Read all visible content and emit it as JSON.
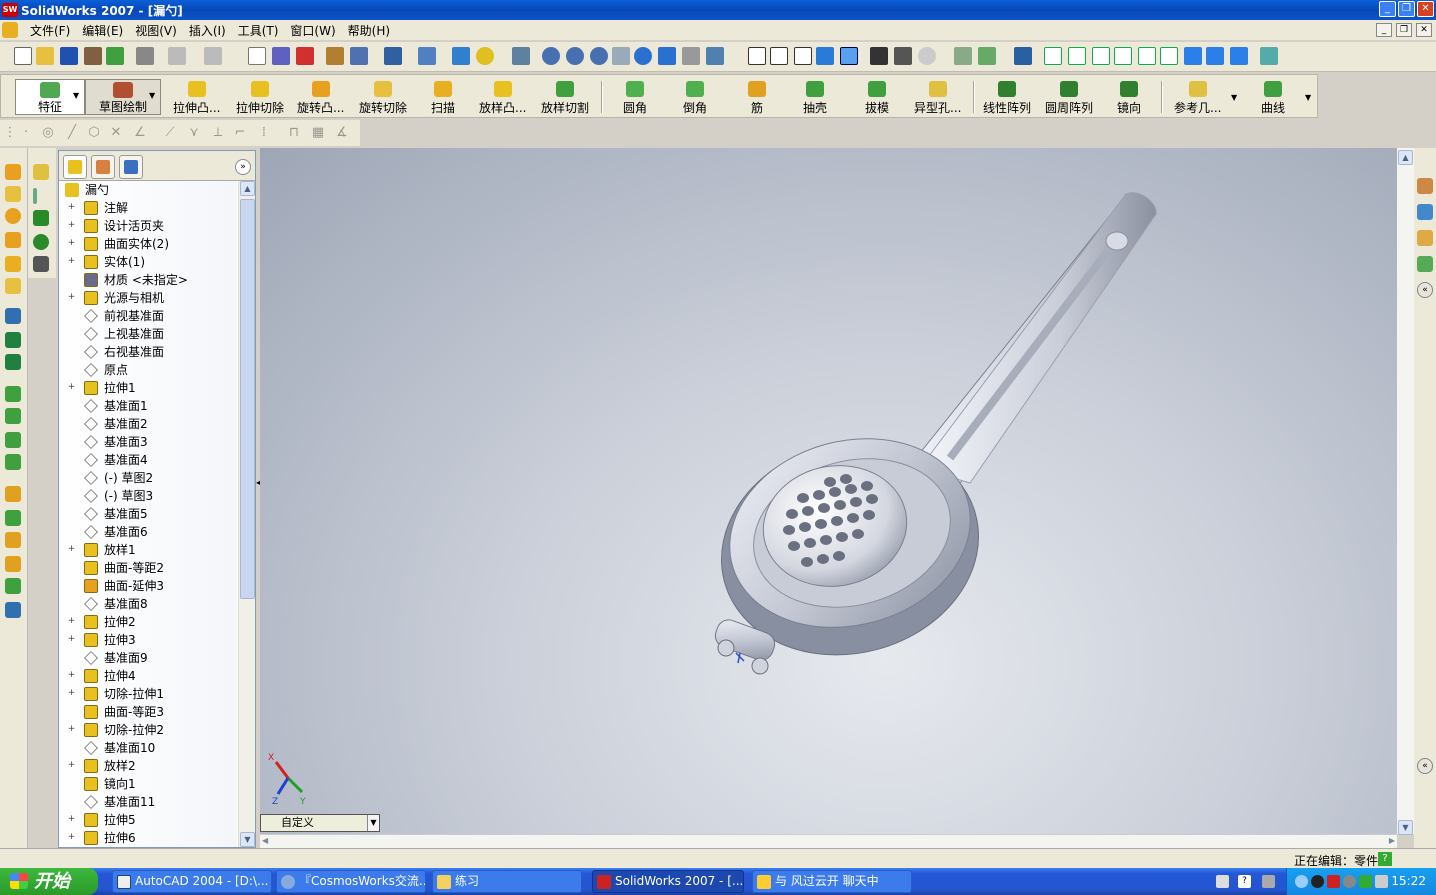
{
  "window": {
    "title": "SolidWorks 2007 - [漏勺]",
    "app_icon": "SW"
  },
  "menu": [
    "文件(F)",
    "编辑(E)",
    "视图(V)",
    "插入(I)",
    "工具(T)",
    "窗口(W)",
    "帮助(H)"
  ],
  "command_manager": {
    "tabs": [
      {
        "label": "特征"
      },
      {
        "label": "草图绘制"
      }
    ],
    "items": [
      {
        "label": "拉伸凸...",
        "color": "#e8c020"
      },
      {
        "label": "拉伸切除",
        "color": "#e8c020"
      },
      {
        "label": "旋转凸...",
        "color": "#e8a020"
      },
      {
        "label": "旋转切除",
        "color": "#e8c040"
      },
      {
        "label": "扫描",
        "color": "#e8b020"
      },
      {
        "label": "放样凸...",
        "color": "#e8c020"
      },
      {
        "label": "放样切割",
        "color": "#40a040"
      },
      {
        "label": "圆角",
        "color": "#50b050"
      },
      {
        "label": "倒角",
        "color": "#50b050"
      },
      {
        "label": "筋",
        "color": "#e0a020"
      },
      {
        "label": "抽壳",
        "color": "#40a040"
      },
      {
        "label": "拔模",
        "color": "#40a040"
      },
      {
        "label": "异型孔...",
        "color": "#e0c040"
      },
      {
        "label": "线性阵列",
        "color": "#308030"
      },
      {
        "label": "圆周阵列",
        "color": "#308030"
      },
      {
        "label": "镜向",
        "color": "#308030"
      },
      {
        "label": "参考几...",
        "color": "#e0c040"
      },
      {
        "label": "曲线",
        "color": "#40a040"
      }
    ]
  },
  "feature_manager": {
    "root": "漏勺",
    "items": [
      {
        "label": "注解",
        "expand": "+",
        "icon": "annotation-icon"
      },
      {
        "label": "设计活页夹",
        "expand": "+",
        "icon": "binder-icon"
      },
      {
        "label": "曲面实体(2)",
        "expand": "+",
        "icon": "surface-bodies-icon"
      },
      {
        "label": "实体(1)",
        "expand": "+",
        "icon": "solid-bodies-icon"
      },
      {
        "label": "材质 <未指定>",
        "expand": "",
        "icon": "material-icon"
      },
      {
        "label": "光源与相机",
        "expand": "+",
        "icon": "lights-icon"
      },
      {
        "label": "前视基准面",
        "expand": "",
        "icon": "plane-icon"
      },
      {
        "label": "上视基准面",
        "expand": "",
        "icon": "plane-icon"
      },
      {
        "label": "右视基准面",
        "expand": "",
        "icon": "plane-icon"
      },
      {
        "label": "原点",
        "expand": "",
        "icon": "origin-icon"
      },
      {
        "label": "拉伸1",
        "expand": "+",
        "icon": "extrude-icon"
      },
      {
        "label": "基准面1",
        "expand": "",
        "icon": "plane-icon"
      },
      {
        "label": "基准面2",
        "expand": "",
        "icon": "plane-icon"
      },
      {
        "label": "基准面3",
        "expand": "",
        "icon": "plane-icon"
      },
      {
        "label": "基准面4",
        "expand": "",
        "icon": "plane-icon"
      },
      {
        "label": "(-) 草图2",
        "expand": "",
        "icon": "sketch-icon"
      },
      {
        "label": "(-) 草图3",
        "expand": "",
        "icon": "sketch-icon"
      },
      {
        "label": "基准面5",
        "expand": "",
        "icon": "plane-icon"
      },
      {
        "label": "基准面6",
        "expand": "",
        "icon": "plane-icon"
      },
      {
        "label": "放样1",
        "expand": "+",
        "icon": "loft-icon"
      },
      {
        "label": "曲面-等距2",
        "expand": "",
        "icon": "surface-offset-icon"
      },
      {
        "label": "曲面-延伸3",
        "expand": "",
        "icon": "surface-extend-icon"
      },
      {
        "label": "基准面8",
        "expand": "",
        "icon": "plane-icon"
      },
      {
        "label": "拉伸2",
        "expand": "+",
        "icon": "extrude-icon"
      },
      {
        "label": "拉伸3",
        "expand": "+",
        "icon": "extrude-icon"
      },
      {
        "label": "基准面9",
        "expand": "",
        "icon": "plane-icon"
      },
      {
        "label": "拉伸4",
        "expand": "+",
        "icon": "extrude-icon"
      },
      {
        "label": "切除-拉伸1",
        "expand": "+",
        "icon": "cut-extrude-icon"
      },
      {
        "label": "曲面-等距3",
        "expand": "",
        "icon": "surface-offset-icon"
      },
      {
        "label": "切除-拉伸2",
        "expand": "+",
        "icon": "cut-extrude-icon"
      },
      {
        "label": "基准面10",
        "expand": "",
        "icon": "plane-icon"
      },
      {
        "label": "放样2",
        "expand": "+",
        "icon": "loft-icon"
      },
      {
        "label": "镜向1",
        "expand": "",
        "icon": "mirror-icon"
      },
      {
        "label": "基准面11",
        "expand": "",
        "icon": "plane-icon"
      },
      {
        "label": "拉伸5",
        "expand": "+",
        "icon": "extrude-icon"
      },
      {
        "label": "拉伸6",
        "expand": "+",
        "icon": "extrude-icon"
      }
    ]
  },
  "viewport": {
    "view_orientation": "自定义",
    "triad": {
      "x": "X",
      "y": "Y",
      "z": "Z"
    }
  },
  "status": {
    "text": "正在编辑：零件"
  },
  "taskbar": {
    "start": "开始",
    "tasks": [
      {
        "label": "AutoCAD 2004 - [D:\\...",
        "active": false
      },
      {
        "label": "『CosmosWorks交流...",
        "active": false
      },
      {
        "label": "练习",
        "active": false
      },
      {
        "label": "SolidWorks 2007 - [...",
        "active": true
      },
      {
        "label": "与 风过云开 聊天中",
        "active": false
      }
    ],
    "clock": "15:22"
  },
  "colors": {
    "accent": "#0a54c8",
    "panel": "#ece9d8",
    "viewport_bg": "#b8bfcc"
  }
}
